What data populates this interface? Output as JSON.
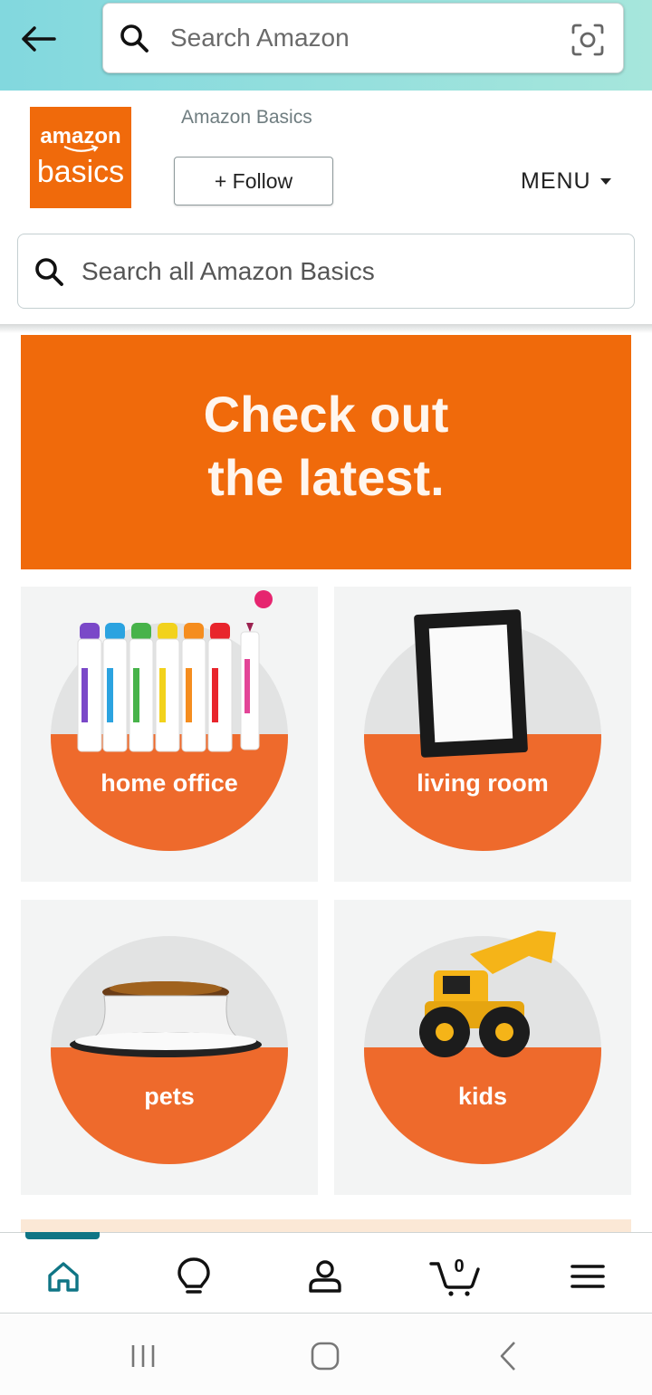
{
  "header": {
    "search_placeholder": "Search Amazon"
  },
  "store": {
    "logo_line1": "amazon",
    "logo_line2": "basics",
    "brand_name": "Amazon Basics",
    "follow_label": "+ Follow",
    "menu_label": "MENU",
    "search_placeholder": "Search all Amazon Basics"
  },
  "banner": {
    "line1": "Check out",
    "line2": "the latest."
  },
  "categories": [
    {
      "label": "home office"
    },
    {
      "label": "living room"
    },
    {
      "label": "pets"
    },
    {
      "label": "kids"
    }
  ],
  "bottom_nav": {
    "cart_count": "0",
    "items": [
      "home-icon",
      "lightbulb-icon",
      "account-icon",
      "cart-icon",
      "hamburger-menu-icon"
    ]
  },
  "colors": {
    "brand_orange": "#f06a0b",
    "tile_orange": "#ee6a2c",
    "accent_teal": "#0f7585"
  }
}
